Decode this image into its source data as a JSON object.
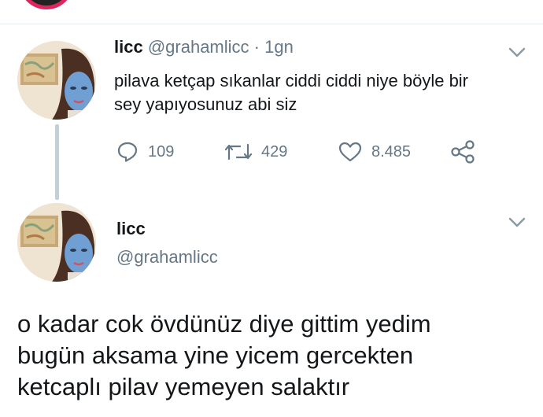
{
  "tweet_1": {
    "name": "licc",
    "handle": "@grahamlicc",
    "separator": "·",
    "time": "1gn",
    "text_lines": [
      "pilava ketçap sıkanlar ciddi ciddi niye böyle bir",
      "sey yapıyosunuz abi siz"
    ],
    "reply_count": "109",
    "retweet_count": "429",
    "like_count": "8.485"
  },
  "tweet_2": {
    "name": "licc",
    "handle": "@grahamlicc",
    "text_lines": [
      "o kadar cok övdünüz diye gittim yedim",
      "bugün aksama yine yicem gercekten",
      "ketcaplı pilav yemeyen salaktır"
    ]
  },
  "icons": {
    "reply": "reply-icon",
    "retweet": "retweet-icon",
    "like": "heart-icon",
    "share": "share-icon",
    "menu": "chevron-down-icon"
  },
  "colors": {
    "text": "#14171a",
    "secondary": "#657786",
    "thread_line": "#c4cfd6",
    "divider": "#e6ecf0",
    "ring": "#e0245e"
  }
}
